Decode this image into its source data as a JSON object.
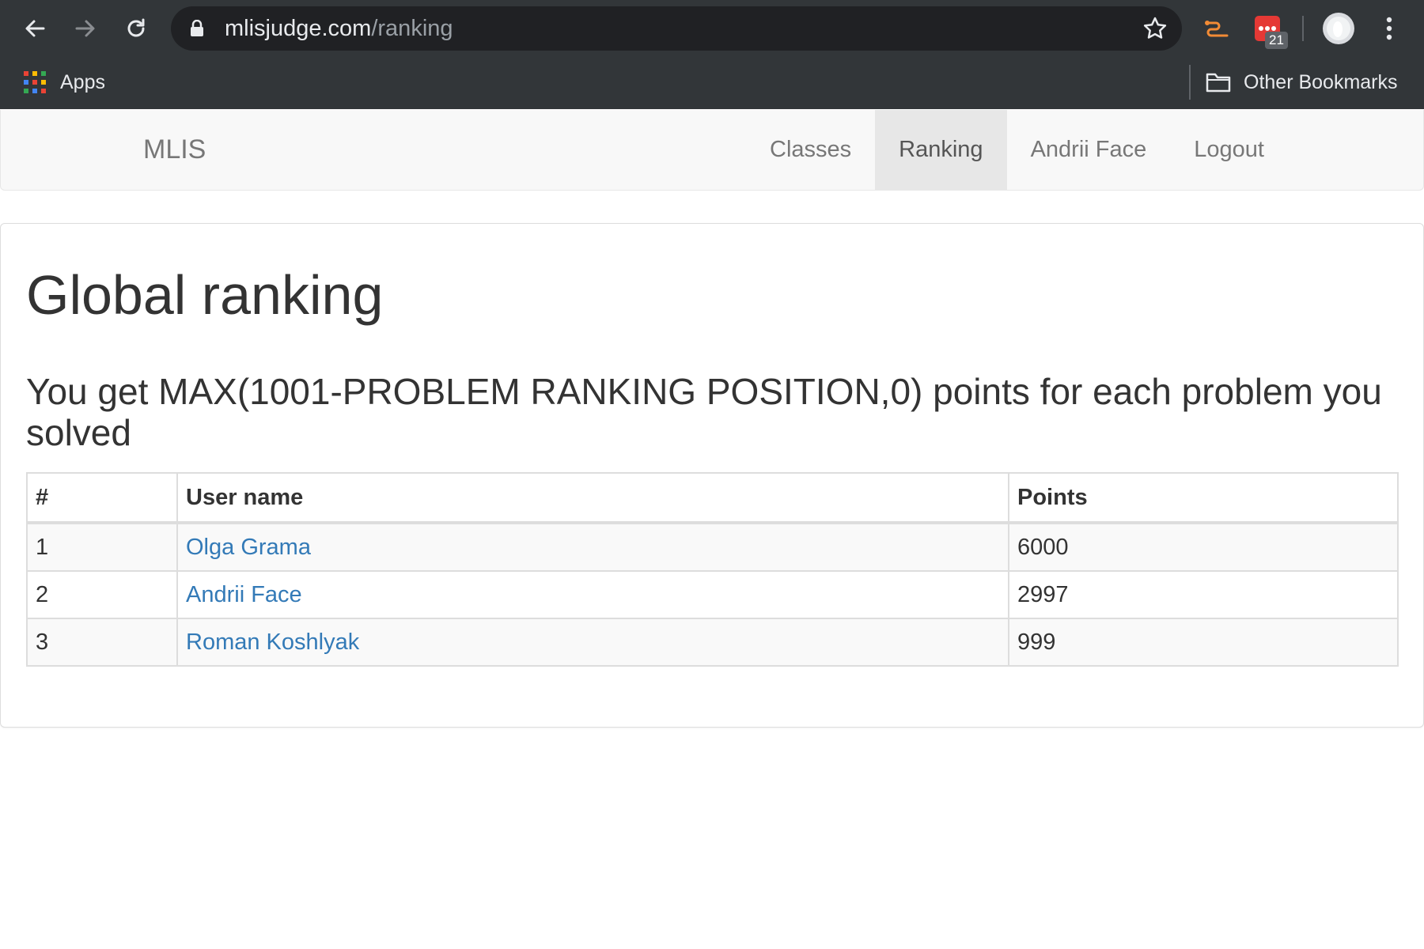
{
  "browser": {
    "url_domain": "mlisjudge.com",
    "url_path": "/ranking",
    "extension_badge": "21",
    "bookmarks": {
      "apps_label": "Apps",
      "other_label": "Other Bookmarks"
    },
    "colors": {
      "chrome_bg": "#323639",
      "omnibox_bg": "#202124"
    }
  },
  "navbar": {
    "brand": "MLIS",
    "links": [
      {
        "label": "Classes",
        "active": false
      },
      {
        "label": "Ranking",
        "active": true
      },
      {
        "label": "Andrii Face",
        "active": false
      },
      {
        "label": "Logout",
        "active": false
      }
    ]
  },
  "page": {
    "title": "Global ranking",
    "subtitle": "You get MAX(1001-PROBLEM RANKING POSITION,0) points for each problem you solved",
    "table": {
      "headers": [
        "#",
        "User name",
        "Points"
      ],
      "rows": [
        {
          "rank": "1",
          "user": "Olga Grama",
          "points": "6000"
        },
        {
          "rank": "2",
          "user": "Andrii Face",
          "points": "2997"
        },
        {
          "rank": "3",
          "user": "Roman Koshlyak",
          "points": "999"
        }
      ]
    },
    "colors": {
      "link": "#337ab7",
      "text": "#333333"
    }
  },
  "icons": [
    "back-arrow-icon",
    "forward-arrow-icon",
    "reload-icon",
    "lock-icon",
    "bookmark-star-icon",
    "route-extension-icon",
    "calendar-extension-icon",
    "profile-avatar-icon",
    "more-menu-icon",
    "apps-grid-icon",
    "folder-icon"
  ]
}
